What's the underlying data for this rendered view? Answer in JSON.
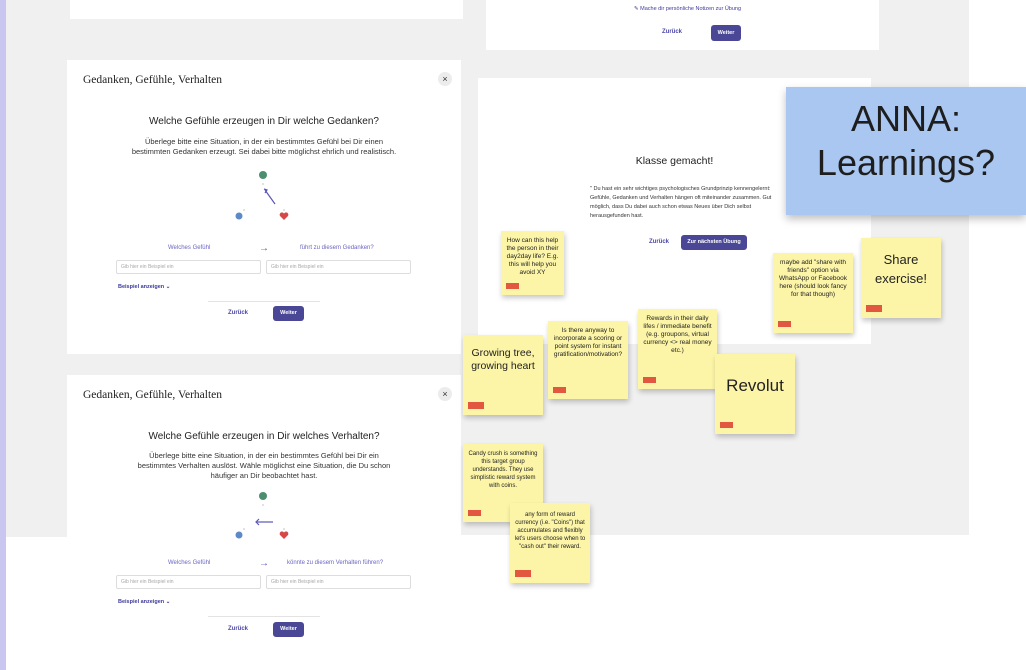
{
  "top_frame": {
    "notes_link": "Mache dir persönliche Notizen zur Übung",
    "back": "Zurück",
    "next": "Weiter"
  },
  "card1": {
    "title": "Gedanken, Gefühle, Verhalten",
    "close": "×",
    "heading": "Welche Gefühle erzeugen in Dir welche Gedanken?",
    "desc": "Überlege bitte eine Situation, in der ein bestimmtes Gefühl bei Dir einen bestimmten Gedanken erzeugt. Sei dabei bitte möglichst ehrlich und realistisch.",
    "left_label": "Welches Gefühl",
    "right_label": "führt zu diesem Gedanken?",
    "input_placeholder": "Gib hier ein Beispiel ein",
    "example_link": "Beispiel anzeigen",
    "back": "Zurück",
    "next": "Weiter"
  },
  "card2": {
    "title": "Gedanken, Gefühle, Verhalten",
    "close": "×",
    "heading": "Welche Gefühle erzeugen in Dir welches Verhalten?",
    "desc": "Überlege bitte eine Situation, in der ein bestimmtes Gefühl bei Dir ein bestimmtes Verhalten auslöst. Wähle möglichst eine Situation, die Du schon häufiger an Dir beobachtet hast.",
    "left_label": "Welches Gefühl",
    "right_label": "könnte zu diesem Verhalten führen?",
    "input_placeholder": "Gib hier ein Beispiel ein",
    "example_link": "Beispiel anzeigen",
    "back": "Zurück",
    "next": "Weiter"
  },
  "card3": {
    "heading": "Klasse gemacht!",
    "desc": "\" Du hast ein sehr wichtiges psychologisches Grundprinzip kennengelernt: Gefühle, Gedanken und Verhalten hängen oft miteinander zusammen. Gut möglich, dass Du dabei auch schon etwas Neues über Dich selbst herausgefunden hast.",
    "back": "Zurück",
    "next": "Zur nächsten Übung"
  },
  "anna_note": "ANNA: Learnings?",
  "stickies": [
    "How can this help the person in their day2day life? E.g. this will help you avoid XY",
    "Growing tree, growing heart",
    "Is there anyway to incorporate a scoring or point system for instant gratification/motivation?",
    "Rewards in their daily lifes / immediate benefit (e.g. groupons, virtual currency <> real money etc.)",
    "Revolut",
    "maybe add \"share with friends\" option via WhatsApp or Facebook here (should look fancy for that though)",
    "Share exercise!",
    "Candy crush is something this target group understands. They use simplistic reward system with coins.",
    "any form of reward currency (i.e. \"Coins\") that accumulates and flexibly let's users choose when to \"cash out\" their reward."
  ],
  "colors": {
    "accent_button": "#4a4896",
    "link": "#6a66c2",
    "sticky": "#fcf5a7",
    "sticky_tag": "#e1573f",
    "anna_note": "#a9c7f0"
  }
}
